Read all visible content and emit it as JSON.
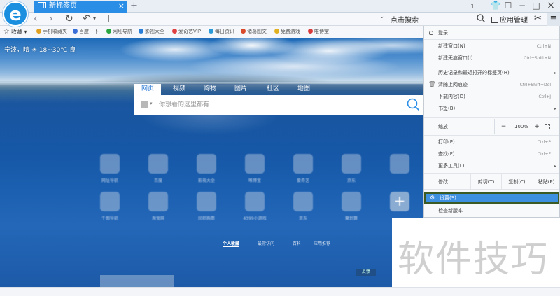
{
  "tabbar": {
    "logo_letter": "e",
    "active_tab_title": "新标签页",
    "tab_close": "×",
    "new_tab": "+",
    "tab_count": "1",
    "icons": [
      "skin-icon",
      "chat-icon",
      "minimize-icon",
      "maximize-icon",
      "close-icon"
    ]
  },
  "nav": {
    "back": "‹",
    "forward": "›",
    "refresh": "↻",
    "undo": "↶",
    "undo_arrow": "▾",
    "address_value": "",
    "address_drop": "⌄",
    "search_label": "点击搜索",
    "app_manager": "应用管理",
    "app_manager_drop": "▾",
    "scissors": "✂",
    "menu": "≡"
  },
  "bookmarks": {
    "favorites_label": "收藏",
    "items": [
      {
        "label": "手机收藏夹",
        "color": "#e0a020"
      },
      {
        "label": "百度一下",
        "color": "#3a6fd8"
      },
      {
        "label": "网址导航",
        "color": "#2aa640"
      },
      {
        "label": "影视大全",
        "color": "#2a7ed8"
      },
      {
        "label": "爱奇艺VIP",
        "color": "#e04040"
      },
      {
        "label": "每日资讯",
        "color": "#2a9ad8"
      },
      {
        "label": "诸葛图文",
        "color": "#d84a2a"
      },
      {
        "label": "免费游戏",
        "color": "#e0b020"
      },
      {
        "label": "唯博宝",
        "color": "#d83a3a"
      }
    ]
  },
  "content": {
    "weather": "宁波，晴 ☀ 18~30℃ 良",
    "search_tabs": [
      "网页",
      "视频",
      "购物",
      "图片",
      "社区",
      "地图"
    ],
    "search_placeholder": "你想看的这里都有",
    "engine_drop": "▾",
    "tiles_row1": [
      "网址导航",
      "百度",
      "影视大全",
      "唯博宝",
      "爱奇艺",
      "京东",
      ""
    ],
    "tiles_row2": [
      "千图导航",
      "淘宝网",
      "民航购票",
      "4399小游戏",
      "京东",
      "聚划算",
      ""
    ],
    "add_tile": "+",
    "category_tabs": [
      "个人收藏",
      "最常访问",
      "百科",
      "应用推荐"
    ],
    "feedback": "反馈"
  },
  "menu": {
    "login": "登录",
    "items_group1": [
      {
        "label": "新建窗口(N)",
        "shortcut": "Ctrl+N"
      },
      {
        "label": "新建无痕窗口(I)",
        "shortcut": "Ctrl+Shift+N"
      }
    ],
    "items_group2": [
      {
        "label": "历史记录和最近打开的标签页(H)",
        "shortcut": "",
        "arrow": "▸",
        "icon": ""
      },
      {
        "label": "清除上网痕迹",
        "shortcut": "Ctrl+Shift+Del",
        "arrow": "",
        "icon": "🗑"
      },
      {
        "label": "下载内容(D)",
        "shortcut": "Ctrl+J",
        "arrow": "",
        "icon": ""
      },
      {
        "label": "书签(B)",
        "shortcut": "",
        "arrow": "▸",
        "icon": ""
      }
    ],
    "zoom": {
      "label": "缩放",
      "minus": "−",
      "value": "100%",
      "plus": "+"
    },
    "items_group3": [
      {
        "label": "打印(P)...",
        "shortcut": "Ctrl+P",
        "arrow": ""
      },
      {
        "label": "查找(F)...",
        "shortcut": "Ctrl+F",
        "arrow": ""
      },
      {
        "label": "更多工具(L)",
        "shortcut": "",
        "arrow": "▸"
      }
    ],
    "edit": {
      "label": "修改",
      "cut": "剪切(T)",
      "copy": "复制(C)",
      "paste": "粘贴(P)"
    },
    "settings": "设置(S)",
    "settings_icon": "⚙",
    "check_update": "检查新版本"
  },
  "watermark": "软件技巧"
}
